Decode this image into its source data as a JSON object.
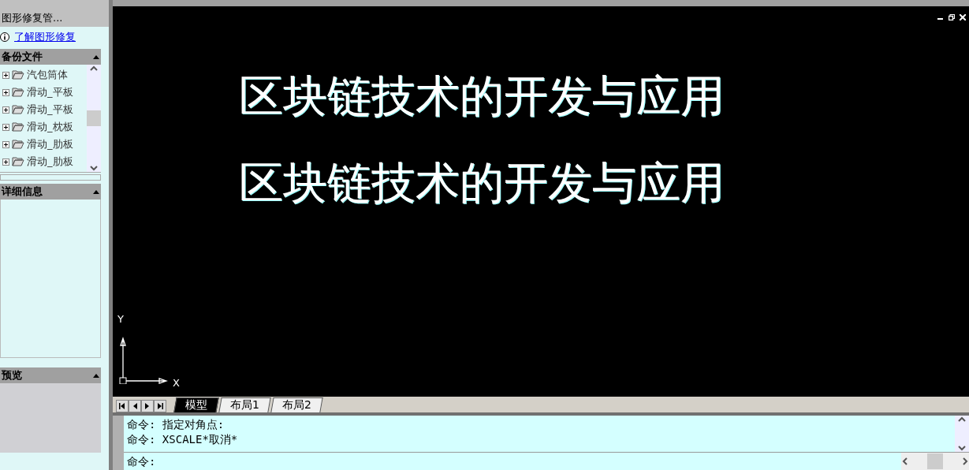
{
  "left_panel": {
    "title": "图形修复管...",
    "help_link": "了解图形修复",
    "sections": [
      {
        "kind": "tree",
        "title": "备份文件",
        "items": [
          {
            "label": "汽包筒体",
            "expanded": false
          },
          {
            "label": "滑动_平板",
            "expanded": false
          },
          {
            "label": "滑动_平板",
            "expanded": false
          },
          {
            "label": "滑动_枕板",
            "expanded": false
          },
          {
            "label": "滑动_肋板",
            "expanded": false
          },
          {
            "label": "滑动_肋板",
            "expanded": false
          }
        ]
      },
      {
        "kind": "details",
        "title": "详细信息"
      },
      {
        "kind": "preview",
        "title": "预览"
      }
    ]
  },
  "drawing": {
    "texts": [
      "区块链技术的开发与应用",
      "区块链技术的开发与应用"
    ],
    "axis_x": "X",
    "axis_y": "Y"
  },
  "layout_tabs": [
    {
      "label": "模型",
      "selected": true
    },
    {
      "label": "布局1",
      "selected": false
    },
    {
      "label": "布局2",
      "selected": false
    }
  ],
  "command": {
    "history": [
      "命令: 指定对角点:",
      "命令: XSCALE*取消*"
    ],
    "prompt": "命令:"
  }
}
